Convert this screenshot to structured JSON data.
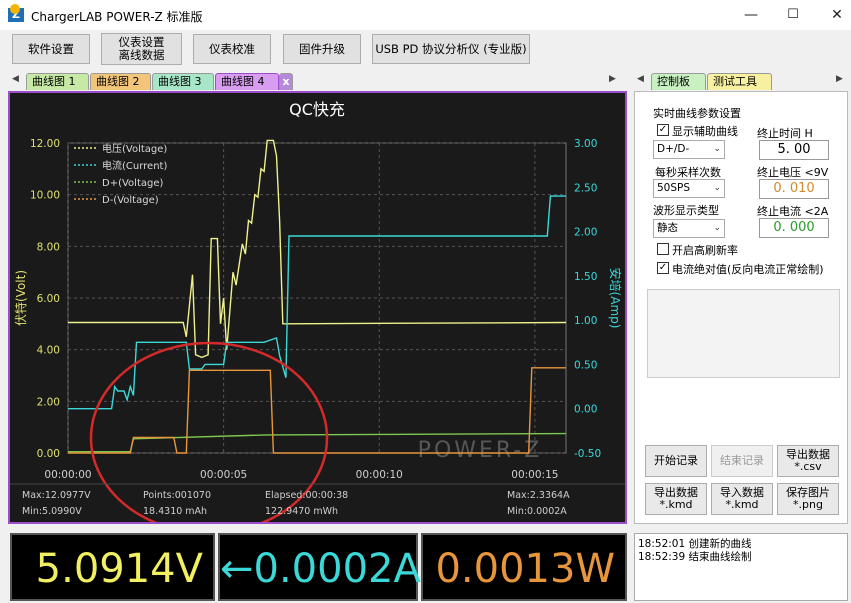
{
  "window": {
    "logo_letter": "Z",
    "title": "ChargerLAB POWER-Z 标准版",
    "minimize": "—",
    "maximize": "☐",
    "close": "✕"
  },
  "toolbar": [
    {
      "label": "软件设置"
    },
    {
      "label": "仪表设置\n离线数据"
    },
    {
      "label": "仪表校准"
    },
    {
      "label": "固件升级"
    },
    {
      "label": "USB PD 协议分析仪 (专业版)"
    }
  ],
  "tabs": {
    "left_arrow": "◀",
    "right_arrow": "▶",
    "items": [
      {
        "label": "曲线图 1",
        "color": "#c6e9a6"
      },
      {
        "label": "曲线图 2",
        "color": "#f2c57a"
      },
      {
        "label": "曲线图 3",
        "color": "#a8e6c8"
      },
      {
        "label": "曲线图 4",
        "color": "#d89cf0"
      }
    ],
    "close_glyph": "x"
  },
  "right_tabs": {
    "items": [
      {
        "label": "控制板",
        "color": "#c8f0c0"
      },
      {
        "label": "测试工具",
        "color": "#f6f0a0"
      }
    ]
  },
  "chart_data": {
    "type": "line",
    "title": "QC快充",
    "ylabel_left": "伏特(Volt)",
    "ylabel_right": "安培(Amp)",
    "y_left_ticks": [
      "12.00",
      "10.00",
      "8.00",
      "6.00",
      "4.00",
      "2.00",
      "0.00"
    ],
    "y_left_range": [
      0,
      12
    ],
    "y_right_ticks": [
      "3.00",
      "2.50",
      "2.00",
      "1.50",
      "1.00",
      "0.50",
      "0.00",
      "-0.50"
    ],
    "y_right_range": [
      -0.5,
      3.0
    ],
    "x_ticks": [
      "00:00:00",
      "00:00:05",
      "00:00:10",
      "00:00:15"
    ],
    "x_range": [
      0,
      16
    ],
    "grid": true,
    "legend_position": "top-left",
    "watermark": "POWER-Z",
    "series": [
      {
        "name": "电压(Voltage)",
        "color": "#f0f08c",
        "axis": "left",
        "points": [
          [
            0,
            5.05
          ],
          [
            3.7,
            5.05
          ],
          [
            3.8,
            4.5
          ],
          [
            4.0,
            6.9
          ],
          [
            4.1,
            3.8
          ],
          [
            4.3,
            3.7
          ],
          [
            4.5,
            3.8
          ],
          [
            4.6,
            8.3
          ],
          [
            4.8,
            8.3
          ],
          [
            4.9,
            5.0
          ],
          [
            5.0,
            6.0
          ],
          [
            5.1,
            4.0
          ],
          [
            5.3,
            7.0
          ],
          [
            5.4,
            6.5
          ],
          [
            5.6,
            8.1
          ],
          [
            5.7,
            7.7
          ],
          [
            5.8,
            9.0
          ],
          [
            5.9,
            8.9
          ],
          [
            6.0,
            10.0
          ],
          [
            6.1,
            9.9
          ],
          [
            6.2,
            11.0
          ],
          [
            6.3,
            10.9
          ],
          [
            6.4,
            12.1
          ],
          [
            6.6,
            12.1
          ],
          [
            6.7,
            11.5
          ],
          [
            6.8,
            9.0
          ],
          [
            6.9,
            5.0
          ],
          [
            7.0,
            5.0
          ],
          [
            16,
            5.05
          ]
        ]
      },
      {
        "name": "电流(Current)",
        "color": "#3cd8d8",
        "axis": "right",
        "points": [
          [
            0,
            0.0
          ],
          [
            1.4,
            0.0
          ],
          [
            1.5,
            0.25
          ],
          [
            1.6,
            0.2
          ],
          [
            1.8,
            0.2
          ],
          [
            1.9,
            0.1
          ],
          [
            2.0,
            0.25
          ],
          [
            2.1,
            0.15
          ],
          [
            2.2,
            0.75
          ],
          [
            3.8,
            0.75
          ],
          [
            3.9,
            0.45
          ],
          [
            4.3,
            0.45
          ],
          [
            4.4,
            0.5
          ],
          [
            5.0,
            0.5
          ],
          [
            5.1,
            0.75
          ],
          [
            6.3,
            0.75
          ],
          [
            6.7,
            0.8
          ],
          [
            6.8,
            0.6
          ],
          [
            7.0,
            0.35
          ],
          [
            7.1,
            1.95
          ],
          [
            15.4,
            1.95
          ],
          [
            15.5,
            2.4
          ],
          [
            16,
            2.4
          ]
        ]
      },
      {
        "name": "D+(Voltage)",
        "color": "#7ec850",
        "axis": "left",
        "points": [
          [
            0,
            0.05
          ],
          [
            2.0,
            0.05
          ],
          [
            2.1,
            0.55
          ],
          [
            6.4,
            0.7
          ],
          [
            16,
            0.75
          ]
        ]
      },
      {
        "name": "D-(Voltage)",
        "color": "#e8963c",
        "axis": "left",
        "points": [
          [
            0,
            0.0
          ],
          [
            2.0,
            0.0
          ],
          [
            2.1,
            0.6
          ],
          [
            3.4,
            0.6
          ],
          [
            3.5,
            0.0
          ],
          [
            3.8,
            0.0
          ],
          [
            3.9,
            3.2
          ],
          [
            6.5,
            3.2
          ],
          [
            6.6,
            0.0
          ],
          [
            14.8,
            0.0
          ],
          [
            14.9,
            3.3
          ],
          [
            16,
            3.3
          ]
        ]
      }
    ]
  },
  "chart_stats": {
    "max_v": "Max:12.0977V",
    "min_v": "Min:5.0990V",
    "points": "Points:001070",
    "mah": "18.4310 mAh",
    "elapsed": "Elapsed:00:00:38",
    "mwh": "122.9470 mWh",
    "max_a": "Max:2.3364A",
    "min_a": "Min:0.0002A"
  },
  "panel": {
    "section_title": "实时曲线参数设置",
    "aux_label": "显示辅助曲线",
    "aux_checked": "✓",
    "aux_select": "D+/D-",
    "sample_label": "每秒采样次数",
    "sample_select": "50SPS",
    "wave_label": "波形显示类型",
    "wave_select": "静态",
    "stop_time_label": "终止时间 H",
    "stop_time_value": "5. 00",
    "stop_volt_label": "终止电压 <9V",
    "stop_volt_value": "0. 010",
    "stop_curr_label": "终止电流 <2A",
    "stop_curr_value": "0. 000",
    "hires_label": "开启高刷新率",
    "abs_label": "电流绝对值(反向电流正常绘制)",
    "abs_checked": "✓",
    "dropdown_glyph": "⌄"
  },
  "panel_buttons": [
    {
      "label": "开始记录",
      "enabled": true
    },
    {
      "label": "结束记录",
      "enabled": false
    },
    {
      "label": "导出数据\n*.csv",
      "enabled": true
    },
    {
      "label": "导出数据\n*.kmd",
      "enabled": true
    },
    {
      "label": "导入数据\n*.kmd",
      "enabled": true
    },
    {
      "label": "保存图片\n*.png",
      "enabled": true
    }
  ],
  "meters": {
    "voltage": "5.0914V",
    "voltage_color": "#f2f060",
    "current": "←0.0002A",
    "current_color": "#3cd8d8",
    "power": "0.0013W",
    "power_color": "#e8963c"
  },
  "log": [
    "18:52:01 创建新的曲线",
    "18:52:39 结束曲线绘制"
  ]
}
